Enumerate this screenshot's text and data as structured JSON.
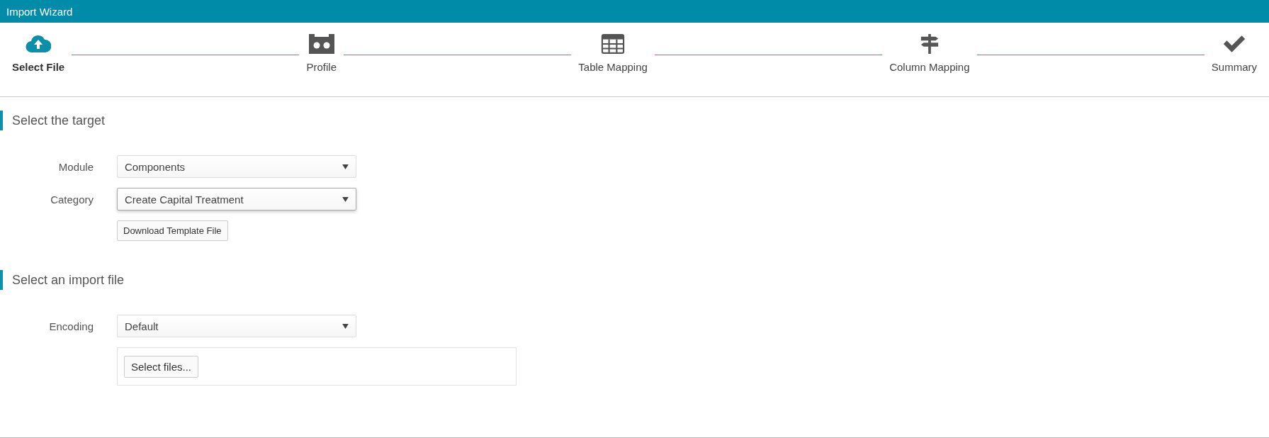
{
  "window": {
    "title": "Import Wizard"
  },
  "steps": [
    {
      "label": "Select File",
      "selected": true
    },
    {
      "label": "Profile",
      "selected": false
    },
    {
      "label": "Table Mapping",
      "selected": false
    },
    {
      "label": "Column Mapping",
      "selected": false
    },
    {
      "label": "Summary",
      "selected": false
    }
  ],
  "sections": [
    {
      "heading": "Select the target",
      "fields": [
        {
          "kind": "dropdown",
          "label": "Module",
          "value": "Components",
          "focused": false
        },
        {
          "kind": "dropdown",
          "label": "Category",
          "value": "Create Capital Treatment",
          "focused": true
        },
        {
          "kind": "button",
          "label": "Download Template File"
        }
      ]
    },
    {
      "heading": "Select an import file",
      "fields": [
        {
          "kind": "dropdown",
          "label": "Encoding",
          "value": "Default",
          "focused": false
        },
        {
          "kind": "upload",
          "label": "Select files..."
        }
      ]
    }
  ]
}
